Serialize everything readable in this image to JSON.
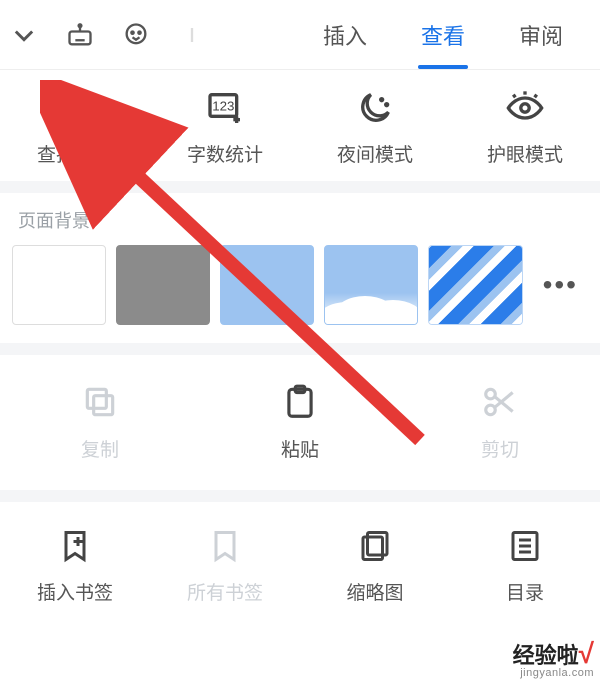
{
  "top_tabs": {
    "insert": "插入",
    "view": "查看",
    "review": "审阅"
  },
  "tools": {
    "find_replace": "查找替换",
    "word_count": "字数统计",
    "night_mode": "夜间模式",
    "eye_care": "护眼模式"
  },
  "section": {
    "page_bg": "页面背景"
  },
  "actions": {
    "copy": "复制",
    "paste": "粘贴",
    "cut": "剪切"
  },
  "bottom": {
    "insert_bookmark": "插入书签",
    "all_bookmarks": "所有书签",
    "thumbnail": "缩略图",
    "contents": "目录"
  },
  "more": "•••",
  "watermark": {
    "text_a": "经验啦",
    "text_b": "√",
    "sub": "jingyanla.com"
  }
}
